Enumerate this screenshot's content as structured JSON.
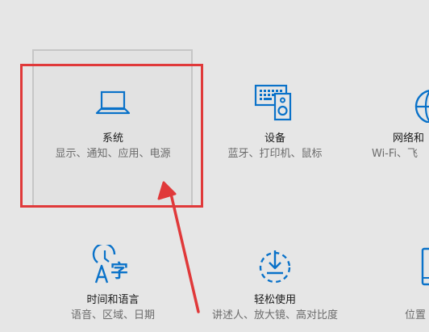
{
  "accent_color": "#0a72c9",
  "annotation_color": "#e0393a",
  "tiles": [
    {
      "title": "系统",
      "desc": "显示、通知、应用、电源",
      "icon": "laptop-icon"
    },
    {
      "title": "设备",
      "desc": "蓝牙、打印机、鼠标",
      "icon": "keyboard-speaker-icon"
    },
    {
      "title": "网络和",
      "desc": "Wi-Fi、飞",
      "icon": "globe-icon"
    },
    {
      "title": "时间和语言",
      "desc": "语音、区域、日期",
      "icon": "time-language-icon"
    },
    {
      "title": "轻松使用",
      "desc": "讲述人、放大镜、高对比度",
      "icon": "ease-of-access-icon"
    },
    {
      "title": "",
      "desc": "位置",
      "icon": "phone-icon"
    }
  ]
}
